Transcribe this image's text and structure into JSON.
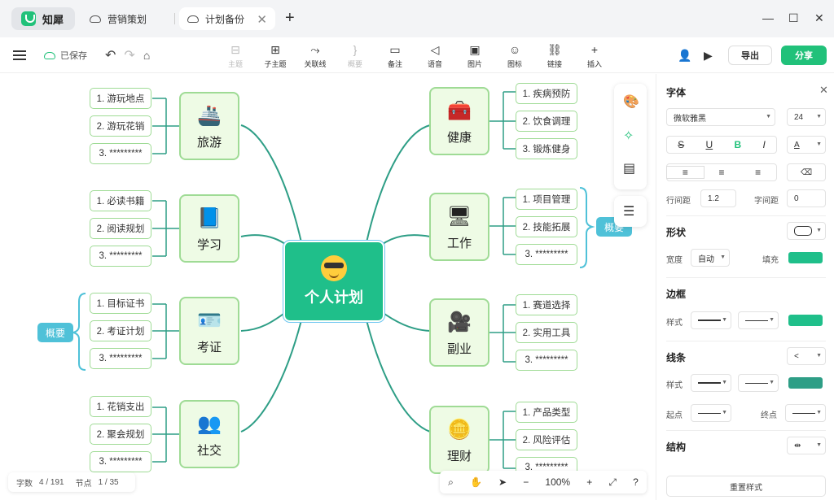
{
  "app": {
    "name": "知犀"
  },
  "tabs": [
    {
      "label": "营销策划"
    },
    {
      "label": "计划备份"
    }
  ],
  "toolbar": {
    "saved": "已保存",
    "tools": [
      {
        "label": "主题",
        "icon": "topic-icon",
        "glyph": "⊟",
        "disabled": true
      },
      {
        "label": "子主题",
        "icon": "subtopic-icon",
        "glyph": "⊞",
        "disabled": false
      },
      {
        "label": "关联线",
        "icon": "relation-line-icon",
        "glyph": "⤳",
        "disabled": false
      },
      {
        "label": "概要",
        "icon": "summary-icon",
        "glyph": "}",
        "disabled": true
      },
      {
        "label": "备注",
        "icon": "note-icon",
        "glyph": "▭",
        "disabled": false
      },
      {
        "label": "语音",
        "icon": "voice-icon",
        "glyph": "◁",
        "disabled": false
      },
      {
        "label": "图片",
        "icon": "image-icon",
        "glyph": "▣",
        "disabled": false
      },
      {
        "label": "图标",
        "icon": "emoji-icon",
        "glyph": "☺",
        "disabled": false
      },
      {
        "label": "链接",
        "icon": "link-icon",
        "glyph": "⛓",
        "disabled": false
      },
      {
        "label": "插入",
        "icon": "insert-icon",
        "glyph": "+",
        "disabled": false
      }
    ],
    "export": "导出",
    "share": "分享"
  },
  "mindmap": {
    "root": "个人计划",
    "branches": [
      {
        "label": "旅游",
        "icon": "ship-icon",
        "glyph": "🚢",
        "leaves": [
          "1. 游玩地点",
          "2. 游玩花销",
          "3. *********"
        ]
      },
      {
        "label": "学习",
        "icon": "book-icon",
        "glyph": "📘",
        "leaves": [
          "1. 必读书籍",
          "2. 阅读规划",
          "3. *********"
        ]
      },
      {
        "label": "考证",
        "icon": "id-card-icon",
        "glyph": "🪪",
        "leaves": [
          "1. 目标证书",
          "2. 考证计划",
          "3. *********"
        ]
      },
      {
        "label": "社交",
        "icon": "people-icon",
        "glyph": "👥",
        "leaves": [
          "1. 花销支出",
          "2. 聚会规划",
          "3. *********"
        ]
      },
      {
        "label": "健康",
        "icon": "medkit-icon",
        "glyph": "🧰",
        "leaves": [
          "1. 疾病预防",
          "2. 饮食调理",
          "3. 锻炼健身"
        ]
      },
      {
        "label": "工作",
        "icon": "computer-icon",
        "glyph": "🖥",
        "leaves": [
          "1. 项目管理",
          "2. 技能拓展",
          "3. *********"
        ]
      },
      {
        "label": "副业",
        "icon": "camera-icon",
        "glyph": "🎥",
        "leaves": [
          "1. 赛道选择",
          "2. 实用工具",
          "3. *********"
        ]
      },
      {
        "label": "理财",
        "icon": "coin-icon",
        "glyph": "🪙",
        "leaves": [
          "1. 产品类型",
          "2. 风险评估",
          "3. *********"
        ]
      }
    ],
    "summaries": [
      "概要",
      "概要"
    ]
  },
  "status": {
    "words_label": "字数",
    "words": "4 / 191",
    "nodes_label": "节点",
    "nodes": "1 / 35"
  },
  "zoom": {
    "level": "100%"
  },
  "panel": {
    "font_title": "字体",
    "font_family": "微软雅黑",
    "font_size": "24",
    "line_height_label": "行间距",
    "line_height": "1.2",
    "letter_spacing_label": "字间距",
    "letter_spacing": "0",
    "shape_title": "形状",
    "width_label": "宽度",
    "width_value": "自动",
    "fill_label": "填充",
    "border_title": "边框",
    "style_label": "样式",
    "line_title": "线条",
    "line_style_label": "样式",
    "start_label": "起点",
    "end_label": "终点",
    "structure_title": "结构",
    "reset": "重置样式",
    "colors": {
      "fill": "#1fbf8a",
      "border": "#1fbf8a",
      "line": "#2e9e86",
      "accent": "#21c17a"
    }
  }
}
